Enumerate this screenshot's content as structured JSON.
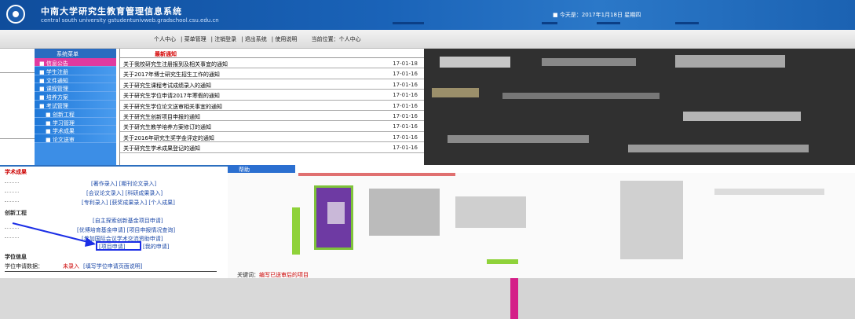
{
  "header": {
    "title": "中南大学研究生教育管理信息系统",
    "subtitle": "central south university  gstudentunivweb.gradschool.csu.edu.cn",
    "today": "■ 今天是：2017年1月18日 星期四"
  },
  "toolbar": {
    "items": [
      "个人中心",
      "菜单管理",
      "注销登录",
      "退出系统",
      "使用说明"
    ],
    "position": "当前位置：个人中心"
  },
  "menu": {
    "title": "系统菜单",
    "items": [
      {
        "label": "■ 信息公告"
      },
      {
        "label": "■ 学生注册"
      },
      {
        "label": "■ 文件通知"
      },
      {
        "label": "■ 课程管理"
      },
      {
        "label": "■ 培养方案"
      },
      {
        "label": "■ 考试管理"
      },
      {
        "label": "■ 创新工程"
      },
      {
        "label": "■ 学习管理"
      },
      {
        "label": "■ 学术成果"
      },
      {
        "label": "■ 论文送审"
      }
    ]
  },
  "news": {
    "title": "最新通知",
    "rows": [
      {
        "text": "关于我校研究生注册报到及相关事宜的通知",
        "date": "17-01-18"
      },
      {
        "text": "关于2017年博士研究生招生工作的通知",
        "date": "17-01-16"
      },
      {
        "text": "关于研究生课程考试成绩录入的通知",
        "date": "17-01-16"
      },
      {
        "text": "关于研究生学位申请2017年寒假的通知",
        "date": "17-01-16"
      },
      {
        "text": "关于研究生学位论文送审相关事宜的通知",
        "date": "17-01-16"
      },
      {
        "text": "关于研究生创新项目申报的通知",
        "date": "17-01-16"
      },
      {
        "text": "关于研究生教学培养方案修订的通知",
        "date": "17-01-16"
      },
      {
        "text": "关于2016年研究生奖学金评定的通知",
        "date": "17-01-16"
      },
      {
        "text": "关于研究生学术成果登记的通知",
        "date": "17-01-16"
      }
    ]
  },
  "left_panel": {
    "section1": "学术成果",
    "links1": [
      "[著作录入] [期刊论文录入]",
      "[会议论文录入] [科研成果录入]",
      "[专利录入] [获奖成果录入] [个人成果]"
    ],
    "section2": "创新工程",
    "links2": [
      "[自主探索创新基金项目申请]",
      "[优博培育基金申请] [项目申报情况查询]",
      "[参加国际会议学术交流资助申请]"
    ],
    "highlighted_link": "[项目申请]",
    "after_highlight": "[我的申请]",
    "section3": "学位信息",
    "degree_label": "学位申请数据：",
    "degree_value": "未录入",
    "degree_extra": "[填写学位申请页面说明]"
  },
  "help": {
    "title": "帮助"
  },
  "keyword": {
    "label": "关键词：",
    "value": "编写已送审后的项目"
  },
  "colors": {
    "header": "#1a63b8",
    "menu": "#3c8ee6",
    "active": "#e03aa0",
    "highlight": "#1b2ee6"
  }
}
